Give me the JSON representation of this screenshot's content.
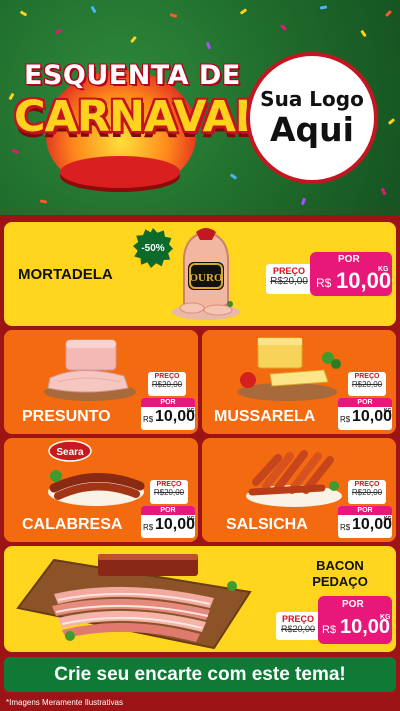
{
  "header": {
    "title_line1": "ESQUENTA DE",
    "title_line2": "CARNAVAL",
    "logo_line1": "Sua Logo",
    "logo_line2": "Aqui"
  },
  "products": {
    "mortadela": {
      "name": "MORTADELA",
      "brand": "OURO",
      "discount": "-50%",
      "price_label": "PREÇO",
      "old_price": "R$20,00",
      "por_label": "POR",
      "currency": "R$",
      "new_price": "10,00",
      "unit": "KG"
    },
    "presunto": {
      "name": "PRESUNTO",
      "price_label": "PREÇO",
      "old_price": "R$20,00",
      "por_label": "POR",
      "currency": "R$",
      "new_price": "10,00",
      "unit": "KG"
    },
    "mussarela": {
      "name": "MUSSARELA",
      "price_label": "PREÇO",
      "old_price": "R$20,00",
      "por_label": "POR",
      "currency": "R$",
      "new_price": "10,00",
      "unit": "KG"
    },
    "calabresa": {
      "name": "CALABRESA",
      "brand": "Seara",
      "price_label": "PREÇO",
      "old_price": "R$20,00",
      "por_label": "POR",
      "currency": "R$",
      "new_price": "10,00",
      "unit": "KG"
    },
    "salsicha": {
      "name": "SALSICHA",
      "price_label": "PREÇO",
      "old_price": "R$20,00",
      "por_label": "POR",
      "currency": "R$",
      "new_price": "10,00",
      "unit": "KG"
    },
    "bacon": {
      "name_line1": "BACON",
      "name_line2": "PEDAÇO",
      "price_label": "PREÇO",
      "old_price": "R$20,00",
      "por_label": "POR",
      "currency": "R$",
      "new_price": "10,00",
      "unit": "KG"
    }
  },
  "footer": {
    "cta": "Crie seu encarte com este tema!",
    "disclaimer": "*Imagens Meramente Ilustrativas"
  },
  "colors": {
    "header_green": "#1f6b2c",
    "background_red": "#9c1416",
    "card_yellow": "#ffd51d",
    "card_orange": "#f36a10",
    "price_pink": "#e8177a",
    "footer_green": "#0f7a36"
  }
}
